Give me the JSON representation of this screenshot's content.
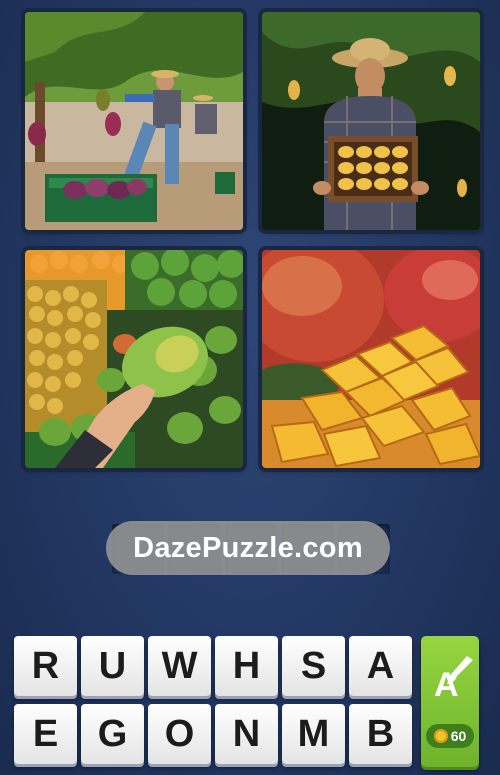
{
  "watermark": "DazePuzzle.com",
  "answer_slots": 5,
  "letters_row1": [
    "R",
    "U",
    "W",
    "H",
    "S",
    "A"
  ],
  "letters_row2": [
    "E",
    "G",
    "O",
    "N",
    "M",
    "B"
  ],
  "hint": {
    "letter": "A",
    "cost": "60"
  }
}
